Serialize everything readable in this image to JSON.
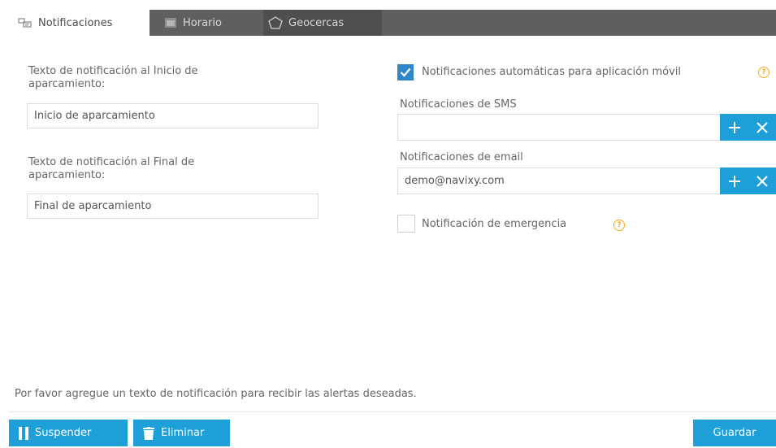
{
  "tabs": [
    {
      "label": "Notificaciones",
      "icon": "notification-icon",
      "active": true
    },
    {
      "label": "Horario",
      "icon": "calendar-icon",
      "active": false
    },
    {
      "label": "Geocercas",
      "icon": "pentagon-icon",
      "active": false
    }
  ],
  "left": {
    "start_label": "Texto de notificación al Inicio de aparcamiento:",
    "start_value": "Inicio de aparcamiento",
    "end_label": "Texto de notificación al Final de aparcamiento:",
    "end_value": "Final de aparcamiento"
  },
  "right": {
    "auto_label": "Notificaciones automáticas para aplicación móvil",
    "auto_checked": true,
    "sms_label": "Notificaciones de SMS",
    "sms_value": "",
    "email_label": "Notificaciones de email",
    "email_value": "demo@navixy.com",
    "emergency_label": "Notificación de emergencia",
    "emergency_checked": false,
    "help_glyph": "?"
  },
  "hint": "Por favor agregue un texto de notificación para recibir las alertas deseadas.",
  "buttons": {
    "suspend": "Suspender",
    "delete": "Eliminar",
    "save": "Guardar"
  },
  "colors": {
    "accent": "#1e9fd8",
    "tabbar": "#5f5f5f",
    "checkbox": "#2f86c8",
    "help": "#f3a91b"
  }
}
